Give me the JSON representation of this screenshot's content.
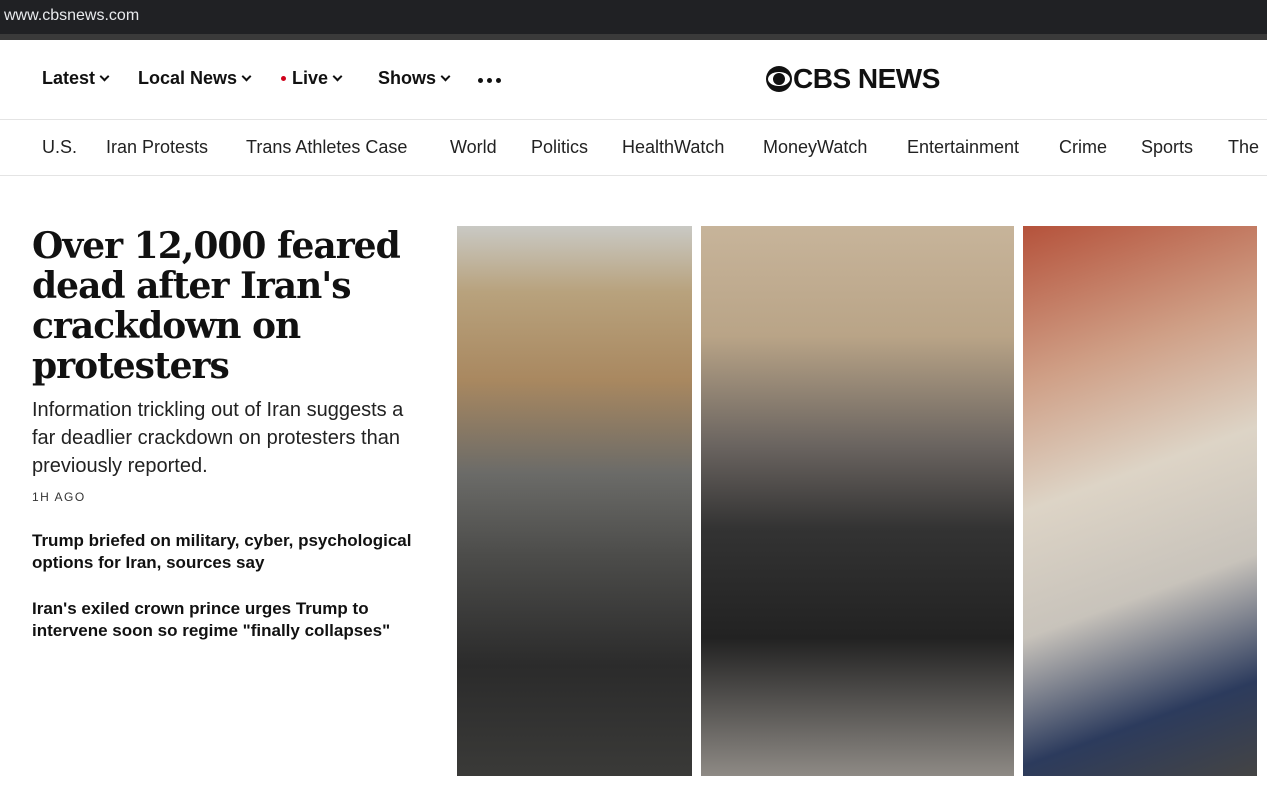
{
  "browser": {
    "url": "www.cbsnews.com"
  },
  "topnav": {
    "items": [
      {
        "label": "Latest",
        "dropdown": true
      },
      {
        "label": "Local News",
        "dropdown": true
      },
      {
        "label": "Live",
        "dropdown": true,
        "live_dot_color": "#d0021b"
      },
      {
        "label": "Shows",
        "dropdown": true
      }
    ],
    "more_icon": "more-dots-icon",
    "logo_text": "CBS NEWS",
    "logo_icon": "cbs-eye-icon"
  },
  "sections": [
    "U.S.",
    "Iran Protests",
    "Trans Athletes Case",
    "World",
    "Politics",
    "HealthWatch",
    "MoneyWatch",
    "Entertainment",
    "Crime",
    "Sports",
    "The"
  ],
  "lead_story": {
    "headline": "Over 12,000 feared dead after Iran's crackdown on protesters",
    "dek": "Information trickling out of Iran suggests a far deadlier crackdown on protesters than previously reported.",
    "timestamp": "1H AGO"
  },
  "related_stories": [
    "Trump briefed on military, cyber, psychological options for Iran, sources say",
    "Iran's exiled crown prince urges Trump to intervene soon so regime \"finally collapses\""
  ]
}
